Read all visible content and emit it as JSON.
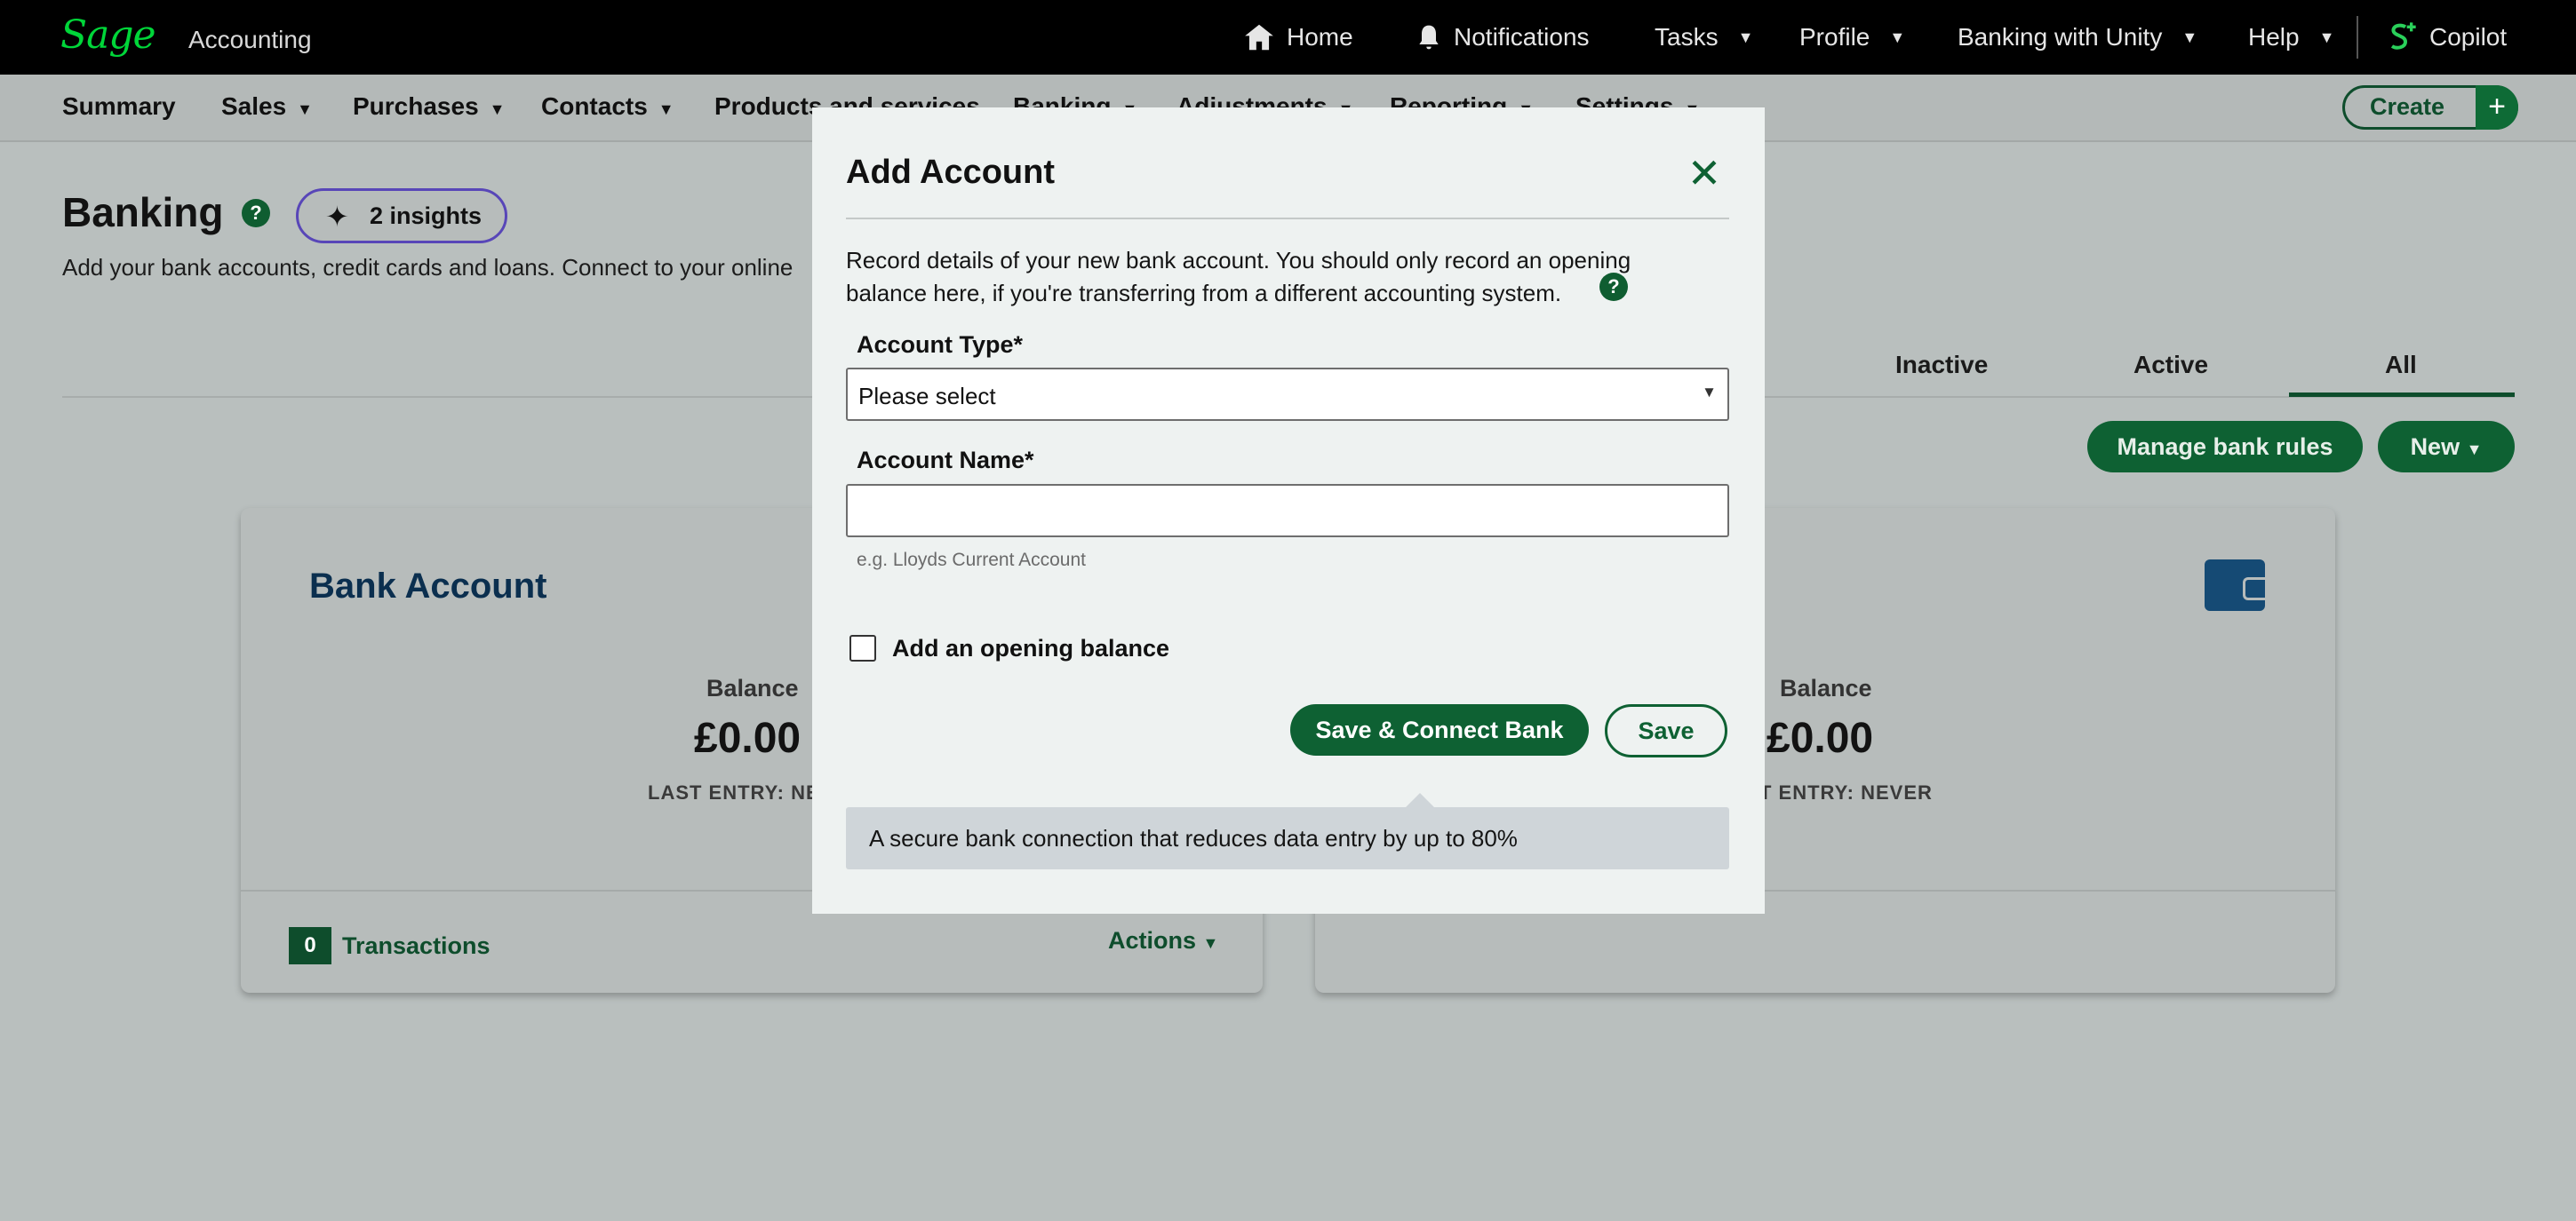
{
  "header": {
    "logo": "Sage",
    "app_name": "Accounting",
    "nav": [
      {
        "label": "Home",
        "icon": "home-icon"
      },
      {
        "label": "Notifications",
        "icon": "bell-icon"
      },
      {
        "label": "Tasks"
      },
      {
        "label": "Profile"
      },
      {
        "label": "Banking with Unity"
      },
      {
        "label": "Help"
      },
      {
        "label": "Copilot",
        "icon": "copilot-icon"
      }
    ]
  },
  "subnav": {
    "items": [
      "Summary",
      "Sales",
      "Purchases",
      "Contacts",
      "Products and services",
      "Banking",
      "Adjustments",
      "Reporting",
      "Settings"
    ],
    "create_label": "Create",
    "create_plus": "+"
  },
  "page": {
    "title": "Banking",
    "help": "?",
    "insights": "2 insights",
    "description": "Add your bank accounts, credit cards and loans. Connect to your online",
    "tabs": [
      "Inactive",
      "Active",
      "All"
    ],
    "selected_tab": "All",
    "manage_rules_label": "Manage bank rules",
    "new_label": "New"
  },
  "cards": [
    {
      "title": "Bank Account",
      "balance_label": "Balance",
      "balance_value": "£0.00",
      "last_entry": "LAST ENTRY: NE",
      "transactions_count": "0",
      "transactions_label": "Transactions",
      "actions_label": "Actions"
    },
    {
      "balance_label": "Balance",
      "balance_value": "£0.00",
      "last_entry": "T ENTRY: NEVER",
      "icon": "wallet-icon"
    }
  ],
  "modal": {
    "title": "Add Account",
    "close": "✕",
    "description": "Record details of your new bank account. You should only record an opening balance here, if you're transferring from a different accounting system.",
    "help": "?",
    "account_type_label": "Account Type*",
    "account_type_value": "Please select",
    "account_name_label": "Account Name*",
    "account_name_value": "",
    "account_name_hint": "e.g. Lloyds Current Account",
    "opening_balance_label": "Add an opening balance",
    "opening_balance_checked": false,
    "save_connect_label": "Save & Connect Bank",
    "save_label": "Save",
    "tooltip": "A secure bank connection that reduces data entry by up to 80%"
  },
  "colors": {
    "brand_green": "#0e6133",
    "logo_green": "#00d639",
    "insights_border": "#5846b8",
    "card_title": "#0b2f4f"
  }
}
